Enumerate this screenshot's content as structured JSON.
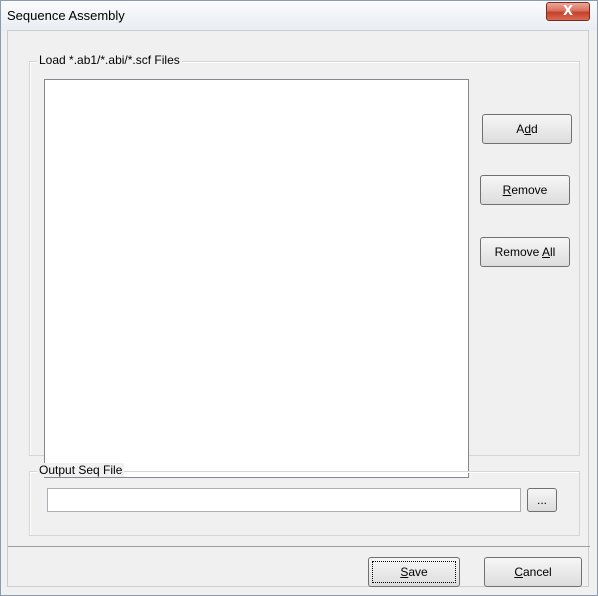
{
  "window": {
    "title": "Sequence Assembly",
    "close_glyph": "X"
  },
  "load_group": {
    "legend": "Load *.ab1/*.abi/*.scf Files",
    "add_label": "A",
    "add_mnemonic": "d",
    "add_rest": "d",
    "remove_mnemonic": "R",
    "remove_rest": "emove",
    "remove_all_prefix": "Remove ",
    "remove_all_mnemonic": "A",
    "remove_all_rest": "ll"
  },
  "output_group": {
    "legend": "Output Seq File",
    "value": "",
    "browse_label": "..."
  },
  "footer": {
    "save_mnemonic": "S",
    "save_rest": "ave",
    "cancel_mnemonic": "C",
    "cancel_rest": "ancel"
  }
}
